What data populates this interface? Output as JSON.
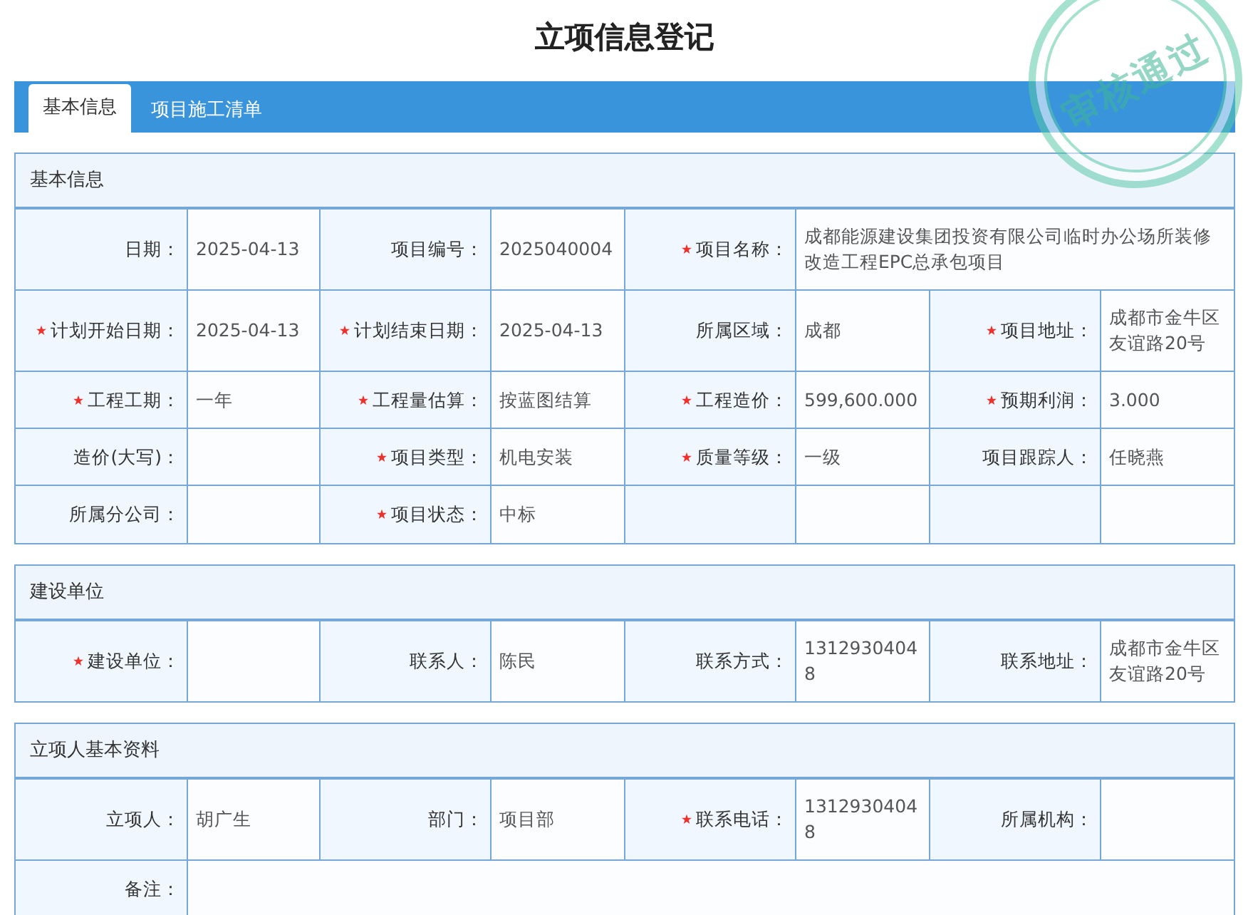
{
  "title": "立项信息登记",
  "tabs": [
    {
      "label": "基本信息",
      "selected": true
    },
    {
      "label": "项目施工清单",
      "selected": false
    }
  ],
  "stamp": {
    "text": "审核通过"
  },
  "sections": [
    {
      "title": "基本信息",
      "rows": [
        [
          {
            "label": "日期：",
            "required": false,
            "value": "2025-04-13"
          },
          {
            "label": "项目编号：",
            "required": false,
            "value": "2025040004"
          },
          {
            "label": "项目名称：",
            "required": true,
            "value": "成都能源建设集团投资有限公司临时办公场所装修改造工程EPC总承包项目",
            "kind": "wide"
          }
        ],
        [
          {
            "label": "计划开始日期：",
            "required": true,
            "value": "2025-04-13"
          },
          {
            "label": "计划结束日期：",
            "required": true,
            "value": "2025-04-13"
          },
          {
            "label": "所属区域：",
            "required": false,
            "value": "成都"
          },
          {
            "label": "项目地址：",
            "required": true,
            "value": "成都市金牛区友谊路20号"
          }
        ],
        [
          {
            "label": "工程工期：",
            "required": true,
            "value": "一年"
          },
          {
            "label": "工程量估算：",
            "required": true,
            "value": "按蓝图结算"
          },
          {
            "label": "工程造价：",
            "required": true,
            "value": "599,600.000"
          },
          {
            "label": "预期利润：",
            "required": true,
            "value": "3.000"
          }
        ],
        [
          {
            "label": "造价(大写)：",
            "required": false
          },
          {
            "label": "项目类型：",
            "required": true,
            "value": "机电安装"
          },
          {
            "label": "质量等级：",
            "required": true,
            "value": "一级"
          },
          {
            "label": "项目跟踪人：",
            "required": false,
            "value": "任晓燕"
          }
        ],
        [
          {
            "label": "所属分公司：",
            "required": false
          },
          {
            "label": "项目状态：",
            "required": true,
            "value": "中标"
          }
        ]
      ]
    },
    {
      "title": "建设单位",
      "rows": [
        [
          {
            "label": "建设单位：",
            "required": true
          },
          {
            "label": "联系人：",
            "required": false,
            "value": "陈民"
          },
          {
            "label": "联系方式：",
            "required": false,
            "value": "13129304048"
          },
          {
            "label": "联系地址：",
            "required": false,
            "value": "成都市金牛区友谊路20号"
          }
        ]
      ]
    },
    {
      "title": "立项人基本资料",
      "rows": [
        [
          {
            "label": "立项人：",
            "required": false,
            "value": "胡广生"
          },
          {
            "label": "部门：",
            "required": false,
            "value": "项目部"
          },
          {
            "label": "联系电话：",
            "required": true,
            "value": "13129304048"
          },
          {
            "label": "所属机构：",
            "required": false
          }
        ],
        [
          {
            "label": "备注：",
            "required": false,
            "kind": "wide"
          }
        ]
      ]
    }
  ]
}
